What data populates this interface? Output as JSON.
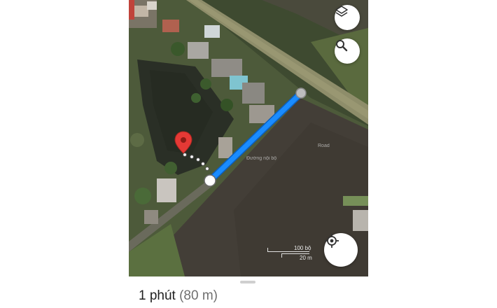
{
  "map": {
    "place_label": "Road",
    "place_label_2": "Đường nội bộ"
  },
  "scale": {
    "top_label": "100 bộ",
    "bottom_label": "20 m"
  },
  "route": {
    "duration": "1 phút",
    "distance": "(80 m)",
    "line_color": "#1a8cff",
    "pin_color": "#e53935"
  },
  "icons": {
    "layers": "layers-icon",
    "search": "search-icon",
    "locate": "my-location-icon"
  }
}
